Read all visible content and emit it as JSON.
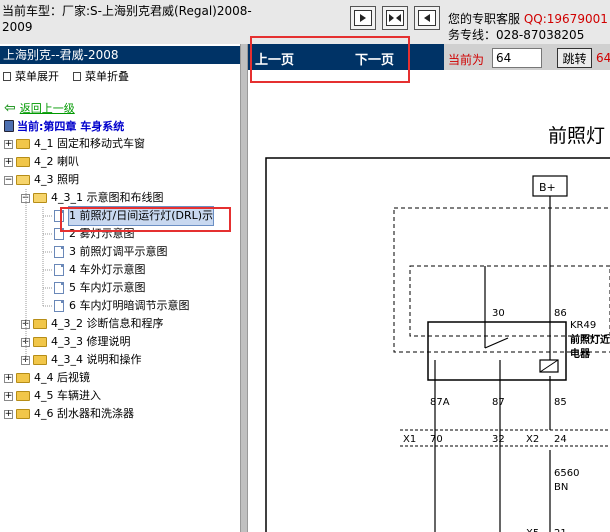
{
  "topbar": {
    "title": "当前车型：厂家:S-上海别克君威(Regal)2008-2009",
    "nav_buttons": [
      {
        "icon": "next-page-icon"
      },
      {
        "icon": "double-arrow-icon"
      },
      {
        "icon": "prev-page-icon"
      }
    ],
    "contact_line1_label": "您的专职客服",
    "contact_qq": "QQ:19679001",
    "contact_line2_label": "务专线：",
    "contact_phone": "028-87038205"
  },
  "left": {
    "header": "上海别克--君威-2008",
    "menu_expand": "菜单展开",
    "menu_collapse": "菜单折叠",
    "back_link": "返回上一级",
    "current": "当前:第四章  车身系统",
    "tree": [
      {
        "label": "4_1 固定和移动式车窗",
        "type": "folder",
        "pm": "+"
      },
      {
        "label": "4_2 喇叭",
        "type": "folder",
        "pm": "+"
      },
      {
        "label": "4_3 照明",
        "type": "folder",
        "pm": "−"
      },
      {
        "label": "4_3_1 示意图和布线图",
        "type": "folder",
        "pm": "−"
      },
      {
        "label": "1 前照灯/日间运行灯(DRL)示",
        "type": "doc",
        "selected": true
      },
      {
        "label": "2 雾灯示意图",
        "type": "doc"
      },
      {
        "label": "3 前照灯调平示意图",
        "type": "doc"
      },
      {
        "label": "4 车外灯示意图",
        "type": "doc"
      },
      {
        "label": "5 车内灯示意图",
        "type": "doc"
      },
      {
        "label": "6 车内灯明暗调节示意图",
        "type": "doc"
      },
      {
        "label": "4_3_2 诊断信息和程序",
        "type": "folder",
        "pm": "+"
      },
      {
        "label": "4_3_3 修理说明",
        "type": "folder",
        "pm": "+"
      },
      {
        "label": "4_3_4 说明和操作",
        "type": "folder",
        "pm": "+"
      },
      {
        "label": "4_4 后视镜",
        "type": "folder",
        "pm": "+"
      },
      {
        "label": "4_5 车辆进入",
        "type": "folder",
        "pm": "+"
      },
      {
        "label": "4_6 刮水器和洗涤器",
        "type": "folder",
        "pm": "+"
      }
    ]
  },
  "right": {
    "prev_page": "上一页",
    "next_page": "下一页",
    "current_label": "当前为",
    "page_value": "64",
    "jump_label": "跳转",
    "total": "64",
    "diagram": {
      "title": "前照灯",
      "bplus": "B+",
      "pin30": "30",
      "pin86": "86",
      "relay_id": "KR49",
      "relay_name_1": "前照灯近",
      "relay_name_2": "电器",
      "pin87a": "87A",
      "pin87": "87",
      "pin85": "85",
      "conn_x1": "X1",
      "conn_x1_pin": "70",
      "conn_x1_pin2": "32",
      "conn_x2": "X2",
      "conn_x2_pin": "24",
      "wire_num": "6560",
      "wire_color": "BN",
      "conn_x5": "X5",
      "conn_x5_pin": "21"
    }
  }
}
